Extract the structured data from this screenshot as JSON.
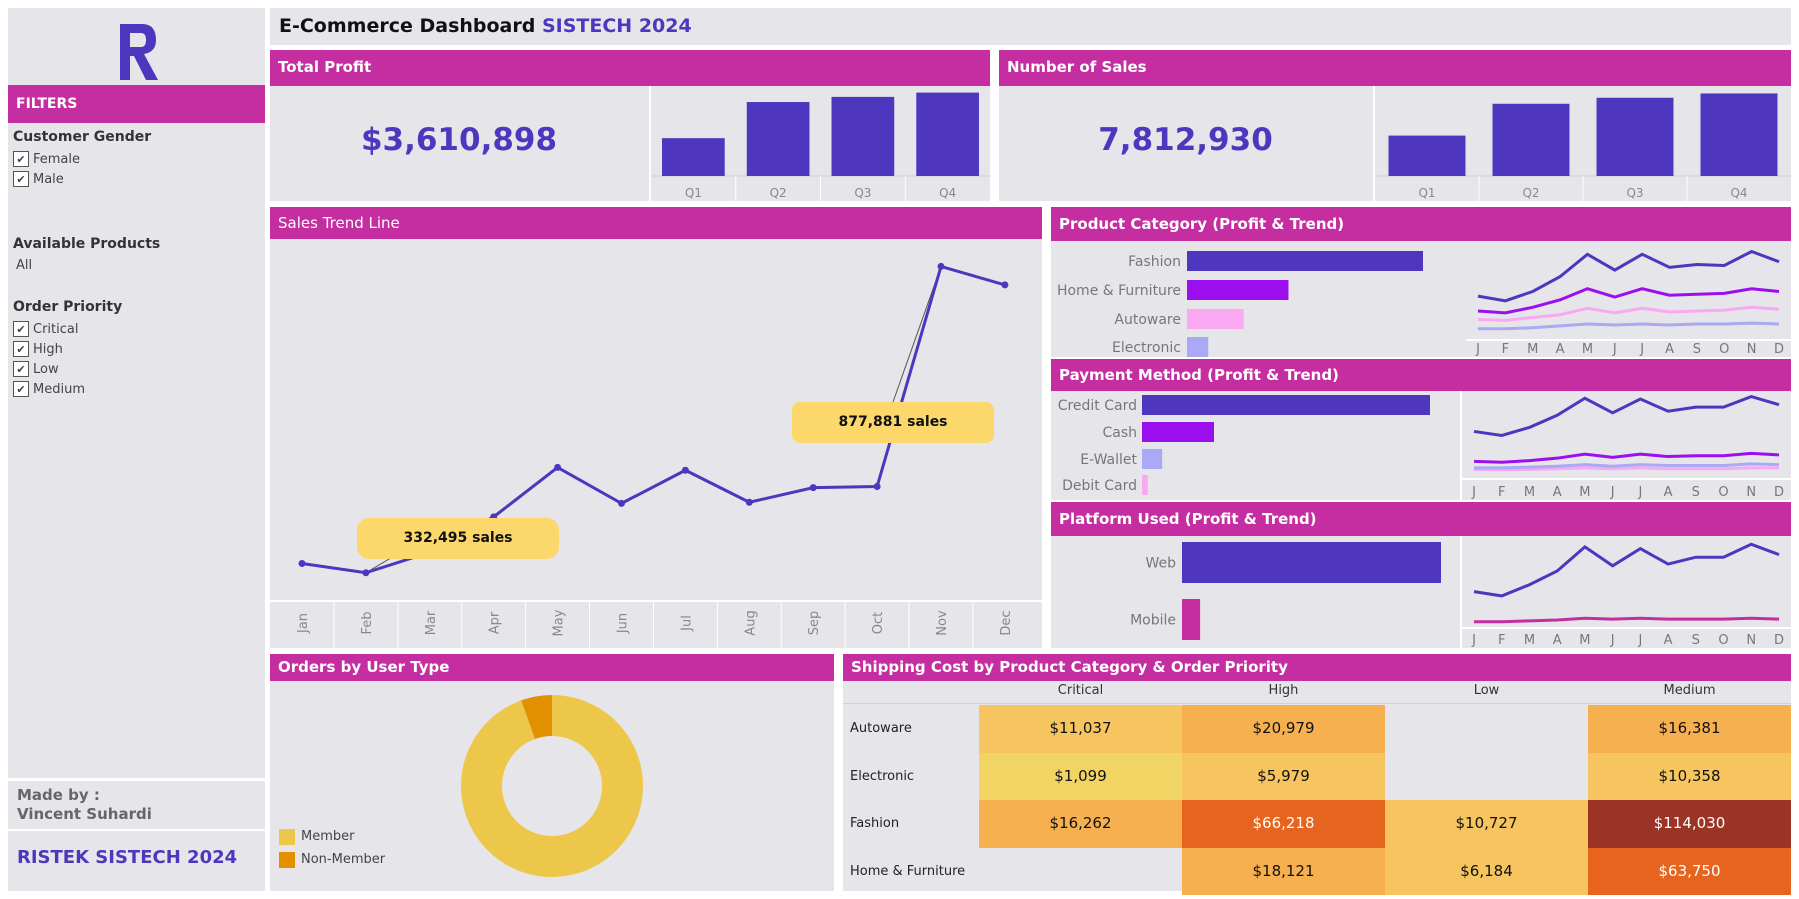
{
  "sidebar": {
    "filters_label": "FILTERS",
    "gender_title": "Customer Gender",
    "gender_options": [
      "Female",
      "Male"
    ],
    "products_title": "Available Products",
    "products_value": "All",
    "priority_title": "Order Priority",
    "priority_options": [
      "Critical",
      "High",
      "Low",
      "Medium"
    ],
    "made_by_label": "Made by :",
    "author": "Vincent Suhardi",
    "org": "RISTEK SISTECH 2024",
    "check": "✔"
  },
  "header": {
    "title": "E-Commerce Dashboard",
    "subtitle": "SISTECH 2024"
  },
  "total_profit": {
    "title": "Total Profit",
    "value": "$3,610,898",
    "chart_data": {
      "type": "bar",
      "categories": [
        "Q1",
        "Q2",
        "Q3",
        "Q4"
      ],
      "values": [
        0.44,
        0.86,
        0.92,
        0.97
      ],
      "unit": "relative"
    }
  },
  "number_of_sales": {
    "title": "Number of Sales",
    "value": "7,812,930",
    "chart_data": {
      "type": "bar",
      "categories": [
        "Q1",
        "Q2",
        "Q3",
        "Q4"
      ],
      "values": [
        0.47,
        0.84,
        0.91,
        0.96
      ],
      "unit": "relative"
    }
  },
  "sales_trend": {
    "title": "Sales Trend Line",
    "chart_data": {
      "type": "line",
      "x": [
        "Jan",
        "Feb",
        "Mar",
        "Apr",
        "May",
        "Jun",
        "Jul",
        "Aug",
        "Sep",
        "Oct",
        "Nov",
        "Dec"
      ],
      "values": [
        349000,
        332495,
        369000,
        432000,
        520000,
        456000,
        515000,
        458000,
        484000,
        486000,
        877881,
        845000
      ],
      "annotations": [
        {
          "label": "332,495 sales",
          "month": "Feb"
        },
        {
          "label": "877,881 sales",
          "month": "Nov"
        }
      ]
    }
  },
  "product_category": {
    "title": "Product Category (Profit & Trend)",
    "chart_data": {
      "type": "bar",
      "categories": [
        "Fashion",
        "Home & Furniture",
        "Autoware",
        "Electronic"
      ],
      "values": [
        1.0,
        0.43,
        0.24,
        0.09
      ],
      "colors": [
        "#4e36be",
        "#9b0fee",
        "#f9a8f2",
        "#a9a9f6"
      ],
      "trend_months": [
        "J",
        "F",
        "M",
        "A",
        "M",
        "J",
        "J",
        "A",
        "S",
        "O",
        "N",
        "D"
      ],
      "trend_series": [
        {
          "name": "Fashion",
          "values": [
            0.45,
            0.4,
            0.5,
            0.66,
            0.9,
            0.73,
            0.9,
            0.76,
            0.79,
            0.78,
            0.93,
            0.82
          ]
        },
        {
          "name": "Home & Furniture",
          "values": [
            0.29,
            0.27,
            0.33,
            0.41,
            0.53,
            0.44,
            0.53,
            0.46,
            0.47,
            0.48,
            0.53,
            0.5
          ]
        },
        {
          "name": "Autoware",
          "values": [
            0.2,
            0.19,
            0.22,
            0.25,
            0.32,
            0.27,
            0.32,
            0.28,
            0.29,
            0.3,
            0.33,
            0.31
          ]
        },
        {
          "name": "Electronic",
          "values": [
            0.1,
            0.1,
            0.11,
            0.13,
            0.15,
            0.14,
            0.15,
            0.14,
            0.15,
            0.15,
            0.16,
            0.15
          ]
        }
      ]
    }
  },
  "payment_method": {
    "title": "Payment Method (Profit & Trend)",
    "chart_data": {
      "type": "bar",
      "categories": [
        "Credit Card",
        "Cash",
        "E-Wallet",
        "Debit Card"
      ],
      "values": [
        1.0,
        0.25,
        0.07,
        0.02
      ],
      "colors": [
        "#4e36be",
        "#9b0fee",
        "#a9a9f6",
        "#f9a8f2"
      ],
      "trend_months": [
        "J",
        "F",
        "M",
        "A",
        "M",
        "J",
        "J",
        "A",
        "S",
        "O",
        "N",
        "D"
      ],
      "trend_series": [
        {
          "name": "Credit Card",
          "values": [
            0.55,
            0.5,
            0.6,
            0.75,
            0.96,
            0.78,
            0.95,
            0.8,
            0.85,
            0.85,
            0.98,
            0.88
          ]
        },
        {
          "name": "Cash",
          "values": [
            0.18,
            0.17,
            0.19,
            0.22,
            0.27,
            0.23,
            0.27,
            0.24,
            0.25,
            0.25,
            0.28,
            0.26
          ]
        },
        {
          "name": "E-Wallet",
          "values": [
            0.1,
            0.1,
            0.11,
            0.12,
            0.14,
            0.12,
            0.14,
            0.13,
            0.13,
            0.13,
            0.15,
            0.14
          ]
        },
        {
          "name": "Debit Card",
          "values": [
            0.08,
            0.08,
            0.08,
            0.09,
            0.1,
            0.09,
            0.1,
            0.09,
            0.09,
            0.09,
            0.1,
            0.1
          ]
        }
      ]
    }
  },
  "platform_used": {
    "title": "Platform Used (Profit & Trend)",
    "chart_data": {
      "type": "bar",
      "categories": [
        "Web",
        "Mobile"
      ],
      "values": [
        1.0,
        0.07
      ],
      "colors": [
        "#4e36be",
        "#c42ea0"
      ],
      "trend_months": [
        "J",
        "F",
        "M",
        "A",
        "M",
        "J",
        "J",
        "A",
        "S",
        "O",
        "N",
        "D"
      ],
      "trend_series": [
        {
          "name": "Web",
          "values": [
            0.4,
            0.35,
            0.48,
            0.64,
            0.92,
            0.7,
            0.9,
            0.72,
            0.8,
            0.8,
            0.95,
            0.83
          ]
        },
        {
          "name": "Mobile",
          "values": [
            0.05,
            0.05,
            0.06,
            0.07,
            0.09,
            0.08,
            0.09,
            0.08,
            0.08,
            0.08,
            0.09,
            0.08
          ]
        }
      ]
    }
  },
  "orders_by_user_type": {
    "title": "Orders by User Type",
    "chart_data": {
      "type": "pie",
      "categories": [
        "Member",
        "Non-Member"
      ],
      "values": [
        94.5,
        5.5
      ],
      "colors": [
        "#ecc74a",
        "#e39000"
      ]
    }
  },
  "shipping_cost": {
    "title": "Shipping Cost by Product Category & Order Priority",
    "columns": [
      "Critical",
      "High",
      "Low",
      "Medium"
    ],
    "rows": [
      {
        "label": "Autoware",
        "cells": [
          "$11,037",
          "$20,979",
          "",
          "$16,381"
        ]
      },
      {
        "label": "Electronic",
        "cells": [
          "$1,099",
          "$5,979",
          "",
          "$10,358"
        ]
      },
      {
        "label": "Fashion",
        "cells": [
          "$16,262",
          "$66,218",
          "$10,727",
          "$114,030"
        ]
      },
      {
        "label": "Home & Furniture",
        "cells": [
          "",
          "$18,121",
          "$6,184",
          "$63,750"
        ]
      }
    ],
    "chart_data": {
      "type": "heatmap",
      "x": [
        "Critical",
        "High",
        "Low",
        "Medium"
      ],
      "y": [
        "Autoware",
        "Electronic",
        "Fashion",
        "Home & Furniture"
      ],
      "values": [
        [
          11037,
          20979,
          null,
          16381
        ],
        [
          1099,
          5979,
          null,
          10358
        ],
        [
          16262,
          66218,
          10727,
          114030
        ],
        [
          null,
          18121,
          6184,
          63750
        ]
      ]
    }
  }
}
